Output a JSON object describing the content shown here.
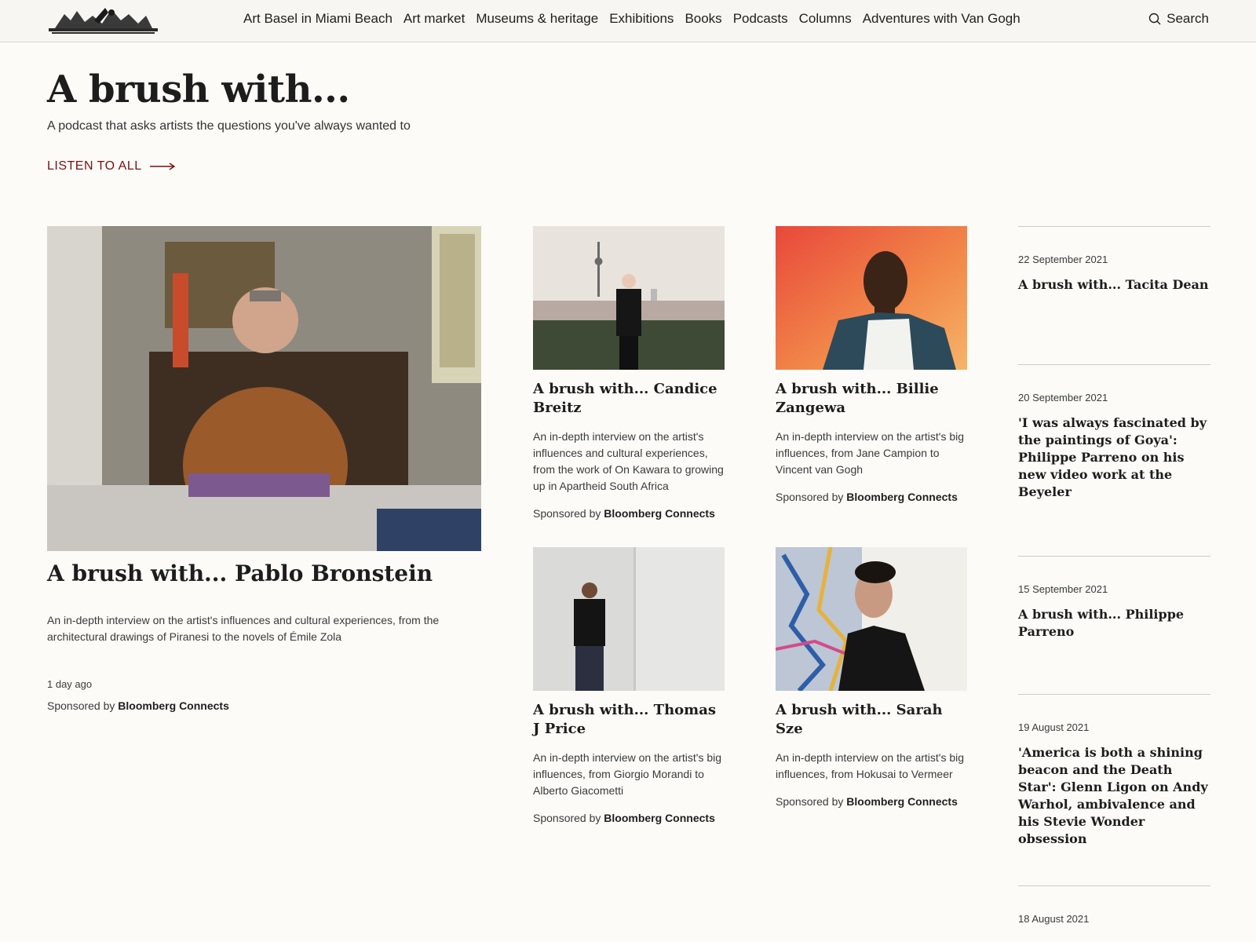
{
  "nav": {
    "logo_alt": "The Art Newspaper",
    "items": [
      {
        "label": "Art Basel in Miami Beach"
      },
      {
        "label": "Art market"
      },
      {
        "label": "Museums & heritage"
      },
      {
        "label": "Exhibitions"
      },
      {
        "label": "Books"
      },
      {
        "label": "Podcasts"
      },
      {
        "label": "Columns"
      },
      {
        "label": "Adventures with Van Gogh"
      }
    ],
    "search_label": "Search"
  },
  "hero": {
    "title": "A brush with...",
    "subtitle": "A podcast that asks artists the questions you've always wanted to",
    "listen_label": "LISTEN TO ALL"
  },
  "featured": {
    "title": "A brush with... Pablo Bronstein",
    "description": "An in-depth interview on the artist's influences and cultural experiences, from the architectural drawings of Piranesi to the novels of Émile Zola",
    "date": "1 day ago",
    "sponsor_prefix": "Sponsored by",
    "sponsor_name": "Bloomberg Connects"
  },
  "cards": [
    {
      "title": "A brush with... Candice Breitz",
      "description": "An in-depth interview on the artist's influences and cultural experiences, from the work of On Kawara to growing up in Apartheid South Africa",
      "sponsor_prefix": "Sponsored by",
      "sponsor_name": "Bloomberg Connects"
    },
    {
      "title": "A brush with... Billie Zangewa",
      "description": "An in-depth interview on the artist's big influences, from Jane Campion to Vincent van Gogh",
      "sponsor_prefix": "Sponsored by",
      "sponsor_name": "Bloomberg Connects"
    },
    {
      "title": "A brush with... Thomas J Price",
      "description": "An in-depth interview on the artist's big influences, from Giorgio Morandi to Alberto Giacometti",
      "sponsor_prefix": "Sponsored by",
      "sponsor_name": "Bloomberg Connects"
    },
    {
      "title": "A brush with... Sarah Sze",
      "description": "An in-depth interview on the artist's big influences, from Hokusai to Vermeer",
      "sponsor_prefix": "Sponsored by",
      "sponsor_name": "Bloomberg Connects"
    }
  ],
  "sidebar": [
    {
      "date": "22 September 2021",
      "title": "A brush with... Tacita Dean"
    },
    {
      "date": "20 September 2021",
      "title": "'I was always fascinated by the paintings of Goya': Philippe Parreno on his new video work at the Beyeler"
    },
    {
      "date": "15 September 2021",
      "title": "A brush with... Philippe Parreno"
    },
    {
      "date": "19 August 2021",
      "title": "'America is both a shining beacon and the Death Star': Glenn Ligon on Andy Warhol, ambivalence and his Stevie Wonder obsession"
    },
    {
      "date": "18 August 2021",
      "title": ""
    }
  ],
  "colors": {
    "accent": "#7a0f12",
    "background": "#fcfbf8",
    "text": "#1f1f1f"
  }
}
